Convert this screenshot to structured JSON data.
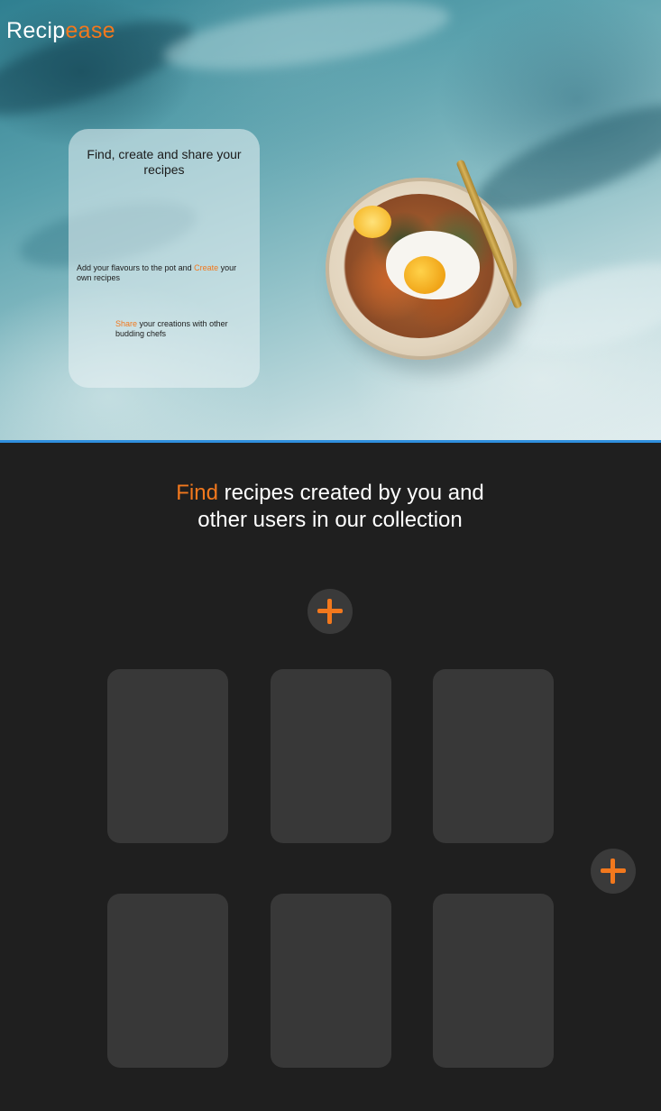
{
  "brand": {
    "logo_part1": "Recip",
    "logo_part2": "ease",
    "accent_color": "#f2781d"
  },
  "hero": {
    "card_title": "Find, create and share your recipes",
    "line1_prefix": "Add your flavours to the pot and ",
    "line1_accent": "Create",
    "line1_suffix": " your own recipes",
    "line2_accent": "Share",
    "line2_suffix": " your creations with other budding chefs"
  },
  "collection": {
    "heading_accent": "Find",
    "heading_rest": " recipes created by you and other users in our collection",
    "add_button_icon": "plus-icon",
    "side_button_icon": "plus-icon",
    "recipe_cards_count_note": ""
  },
  "colors": {
    "background": "#1f1f1f",
    "card": "#383838",
    "button": "#3a3a3a",
    "hero_border": "#2f8fde"
  }
}
